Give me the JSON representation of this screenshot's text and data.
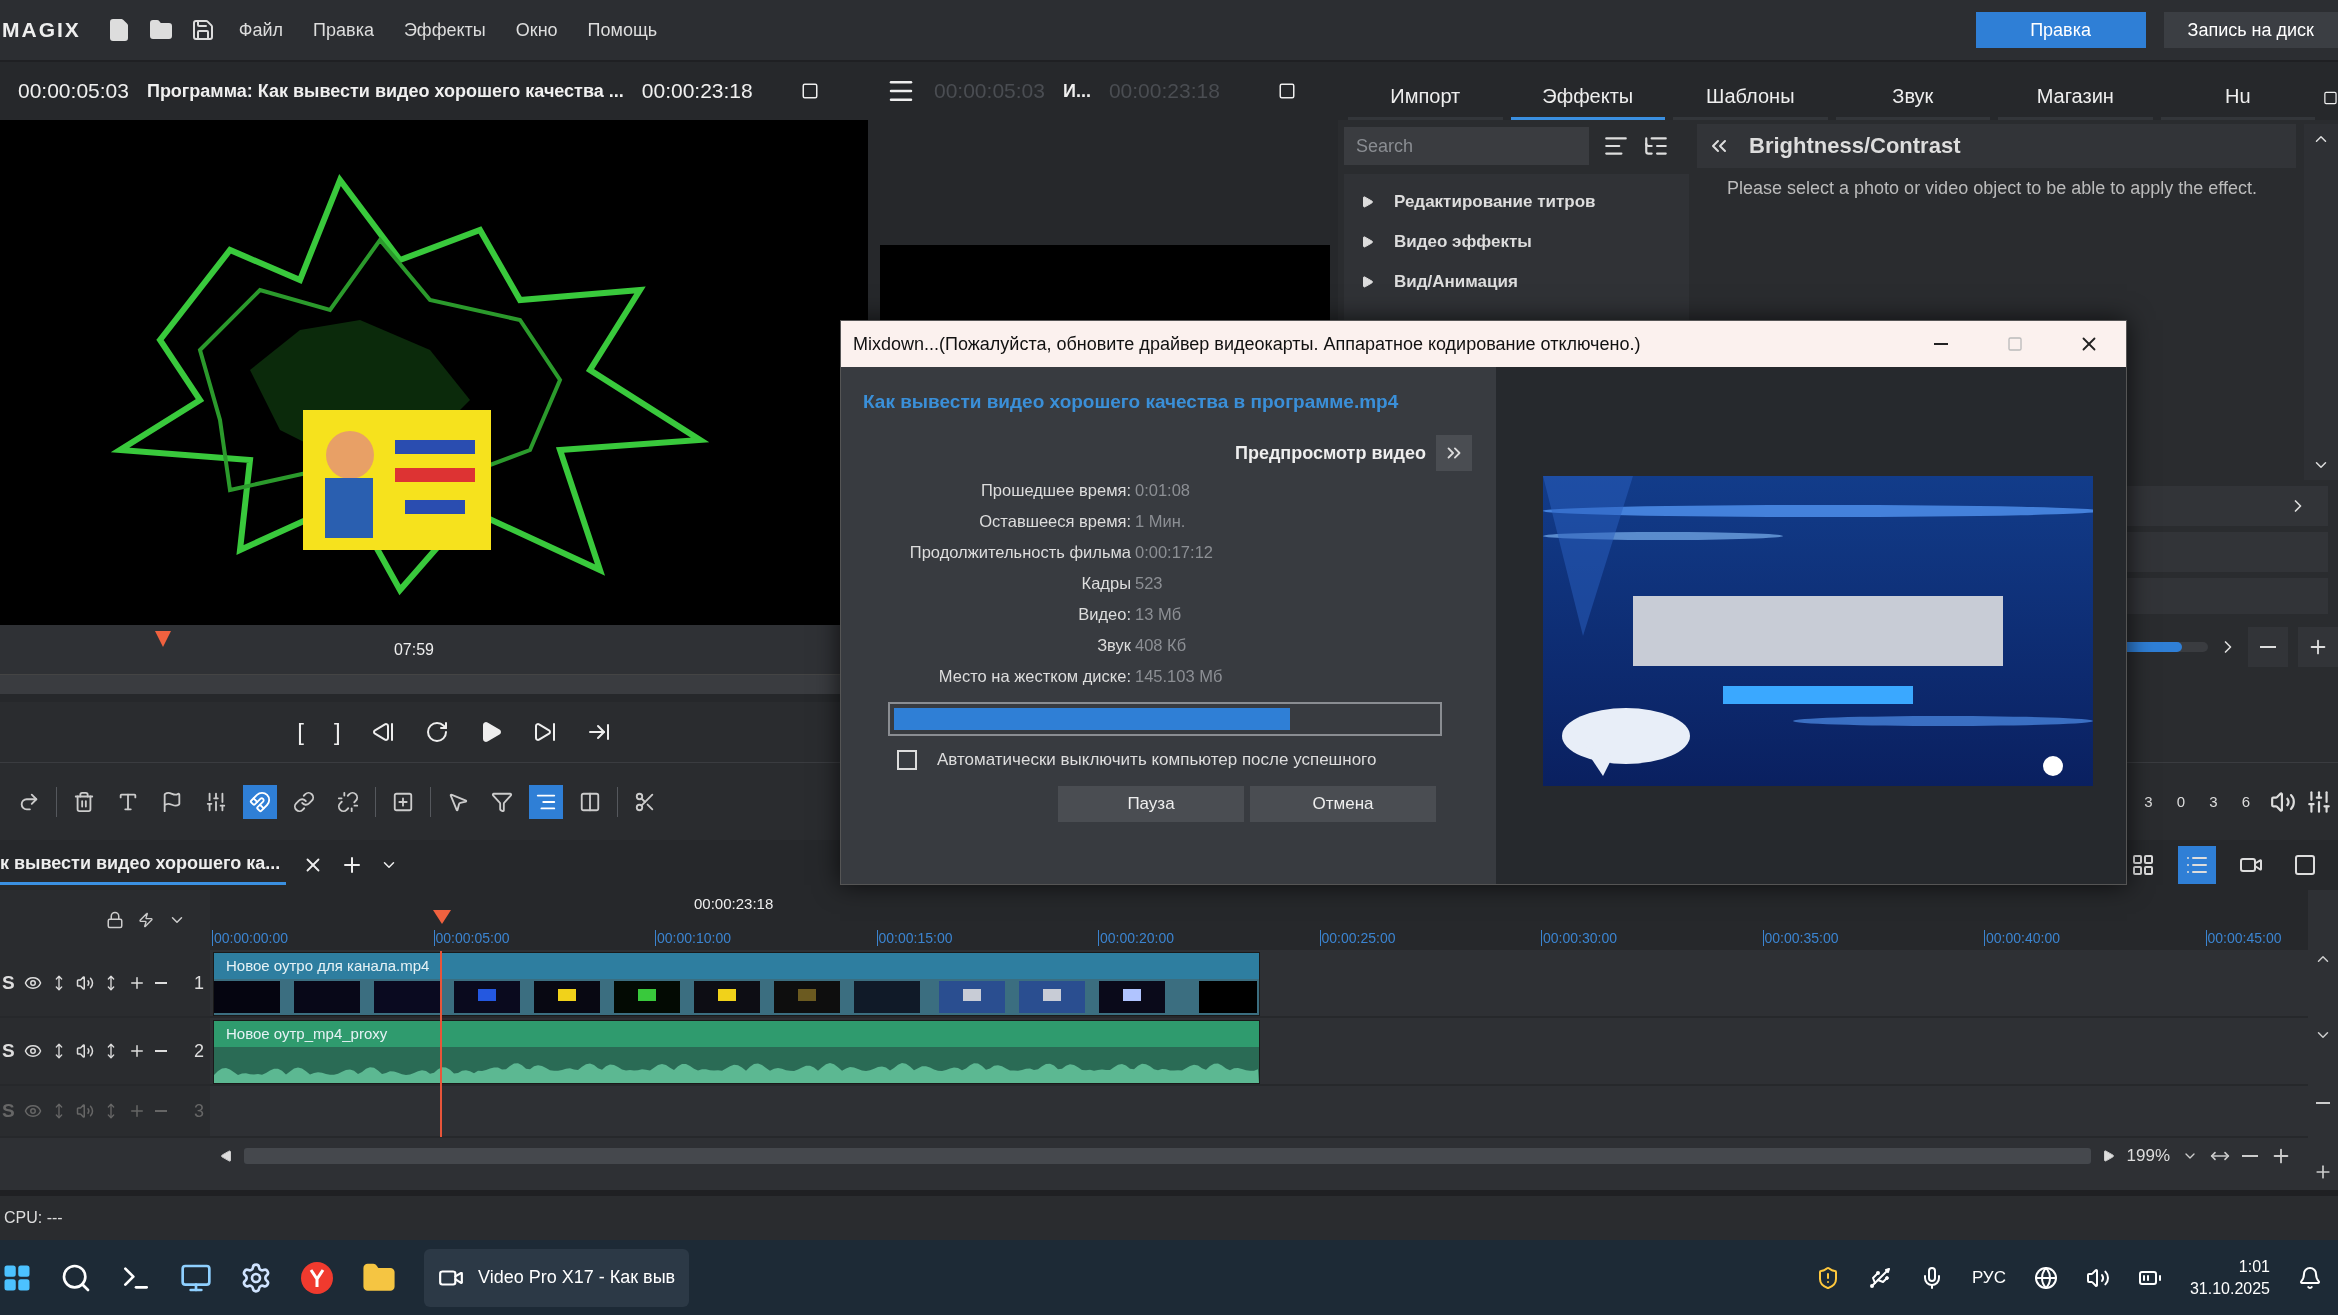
{
  "menu_bar": {
    "logo": "MAGIX",
    "menus": [
      "Файл",
      "Правка",
      "Эффекты",
      "Окно",
      "Помощь"
    ],
    "buttons": [
      {
        "label": "Правка",
        "selected": true
      },
      {
        "label": "Запись на диск",
        "selected": false
      }
    ]
  },
  "preview": {
    "timecode": "00:00:05:03",
    "title": "Программа: Как вывести видео хорошего качества ...",
    "duration": "00:00:23:18",
    "ruler_time": "07:59",
    "transport": [
      {
        "kind": "text",
        "label": "["
      },
      {
        "kind": "text",
        "label": "]"
      },
      {
        "kind": "prev"
      },
      {
        "kind": "loop"
      },
      {
        "kind": "play"
      },
      {
        "kind": "frame"
      },
      {
        "kind": "end"
      }
    ]
  },
  "source_monitor": {
    "timecode": "00:00:05:03",
    "title": "И...",
    "duration": "00:00:23:18"
  },
  "media_pool": {
    "tabs": [
      {
        "label": "Импорт",
        "selected": false
      },
      {
        "label": "Эффекты",
        "selected": true
      },
      {
        "label": "Шаблоны",
        "selected": false
      },
      {
        "label": "Звук",
        "selected": false
      },
      {
        "label": "Магазин",
        "selected": false
      },
      {
        "label": "Hu",
        "selected": false
      }
    ],
    "search": {
      "placeholder": "Search"
    },
    "categories": [
      "Редактирование титров",
      "Видео эффекты",
      "Вид/Анимация"
    ],
    "effect": {
      "title": "Brightness/Contrast",
      "hint": "Please select a photo or video object to be able to apply the effect."
    },
    "slider": {
      "level": 0.97
    },
    "meter_scale": [
      "3",
      "0",
      "3",
      "6"
    ]
  },
  "edit_tools": [
    {
      "kind": "redo",
      "active": false
    },
    {
      "kind": "trash",
      "active": false
    },
    {
      "kind": "text",
      "active": false
    },
    {
      "kind": "flag",
      "active": false
    },
    {
      "kind": "mixer",
      "active": false
    },
    {
      "kind": "magnet",
      "active": true
    },
    {
      "kind": "link",
      "active": false
    },
    {
      "kind": "unlink",
      "active": false
    },
    {
      "kind": "insert",
      "active": false
    },
    {
      "kind": "pointer",
      "active": false
    },
    {
      "kind": "trim",
      "active": false
    },
    {
      "kind": "ripple",
      "active": true
    },
    {
      "kind": "stretch",
      "active": false
    },
    {
      "kind": "cut",
      "active": false
    }
  ],
  "project_tab": {
    "label": "к вывести видео хорошего ка..."
  },
  "views": [
    {
      "kind": "grid",
      "selected": false
    },
    {
      "kind": "list",
      "selected": true
    },
    {
      "kind": "camera",
      "selected": false
    },
    {
      "kind": "square",
      "selected": false
    }
  ],
  "timeline": {
    "position": "00:00:23:18",
    "ticks": [
      "00:00:00:00",
      "00:00:05:00",
      "00:00:10:00",
      "00:00:15:00",
      "00:00:20:00",
      "00:00:25:00",
      "00:00:30:00",
      "00:00:35:00",
      "00:00:40:00",
      "00:00:45:00"
    ],
    "tracks": [
      {
        "number": "1",
        "solo": "S",
        "kind": "video",
        "enabled": true,
        "clip": "Новое оутро для канала.mp4"
      },
      {
        "number": "2",
        "solo": "S",
        "kind": "audio",
        "enabled": true,
        "clip": "Новое оутр_mp4_proxy"
      },
      {
        "number": "3",
        "solo": "S",
        "kind": "empty",
        "enabled": false
      }
    ],
    "zoom": "199%"
  },
  "status_bar": {
    "cpu": "CPU: ---"
  },
  "dialog": {
    "title": "Mixdown...(Пожалуйста, обновите драйвер видеокарты. Аппаратное кодирование отключено.)",
    "file_name": "Как вывести видео хорошего качества в программе.mp4",
    "preview_label": "Предпросмотр видео",
    "stats": [
      {
        "label": "Прошедшее время:",
        "value": "0:01:08"
      },
      {
        "label": "Оставшееся время:",
        "value": "1 Мин."
      },
      {
        "label": "Продолжительность фильма",
        "value": "0:00:17:12"
      },
      {
        "label": "Кадры",
        "value": "523"
      },
      {
        "label": "Видео:",
        "value": "13 Мб"
      },
      {
        "label": "Звук",
        "value": "408 Кб"
      },
      {
        "label": "Место на жестком диске:",
        "value": "145.103 Мб"
      }
    ],
    "progress": {
      "level": 0.73
    },
    "shutdown": {
      "label": "Автоматически выключить компьютер после успешного",
      "checked": false
    },
    "buttons": [
      "Пауза",
      "Отмена"
    ]
  },
  "taskbar": {
    "app": "Video Pro X17 - Как выв",
    "language": "РУС",
    "time": "1:01",
    "date": "31.10.2025"
  }
}
